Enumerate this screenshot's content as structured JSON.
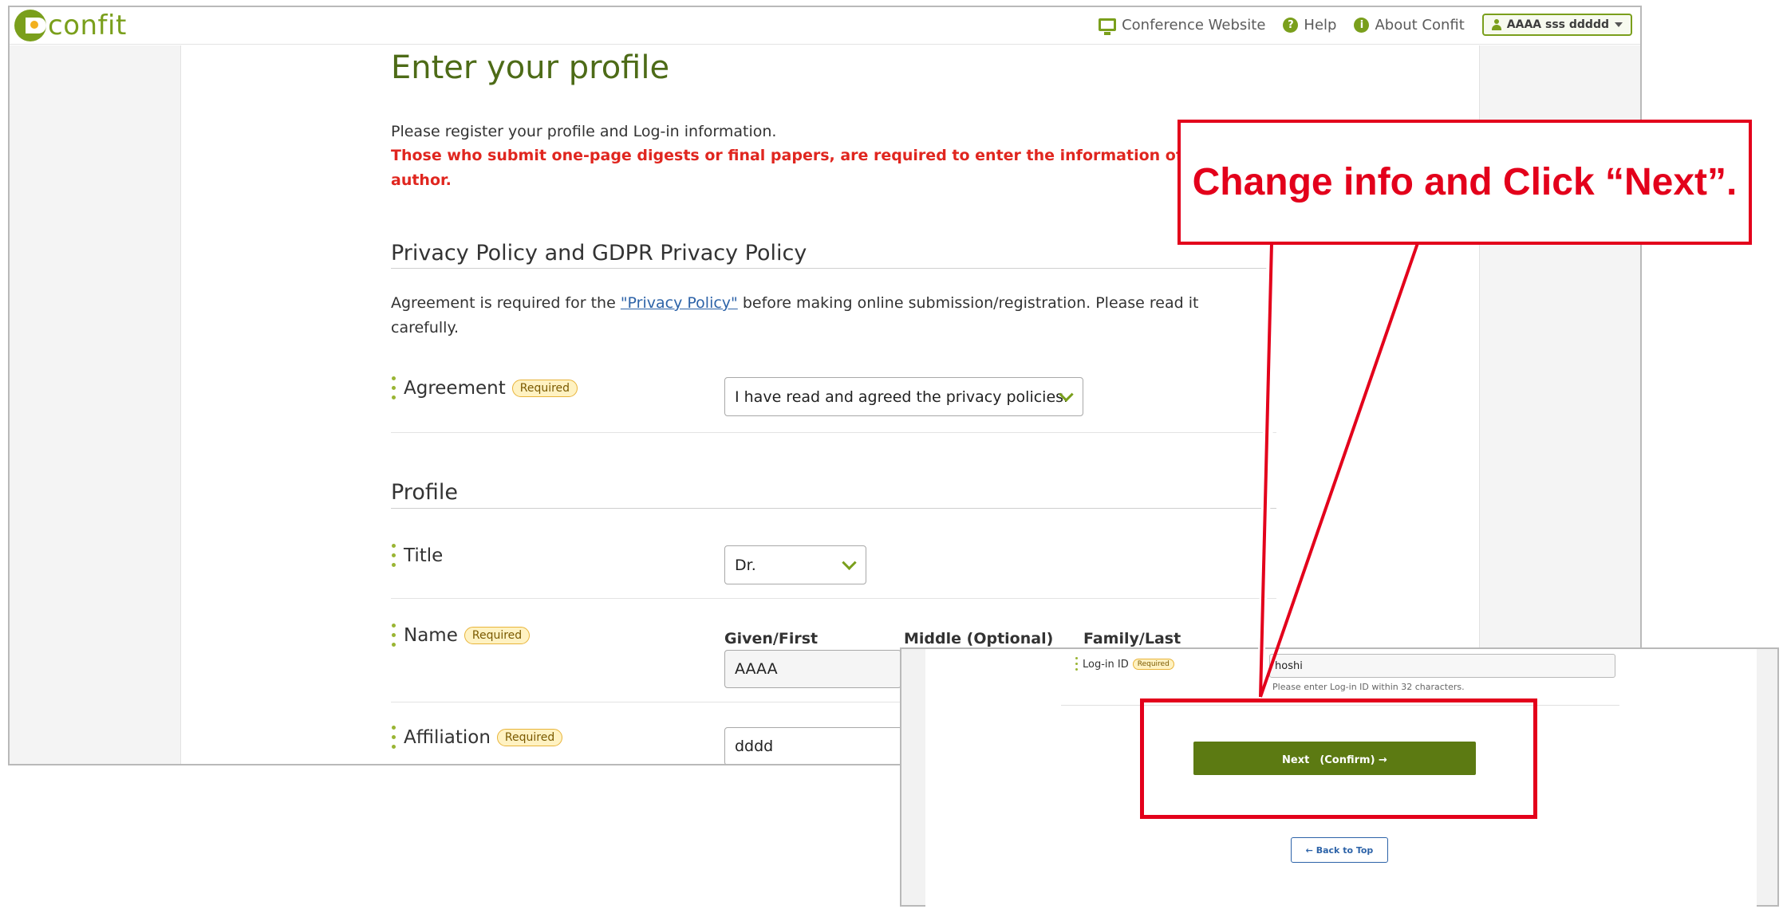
{
  "header": {
    "logo_text": "confit",
    "nav": {
      "conference_website": "Conference Website",
      "help": "Help",
      "about": "About Confit",
      "user": "AAAA sss ddddd"
    }
  },
  "page": {
    "title": "Enter your profile",
    "intro": "Please register your profile and Log-in information.",
    "warning_line1": "Those who submit one-page digests or final papers, are required to enter the information of th",
    "warning_line2": "author."
  },
  "privacy": {
    "heading": "Privacy Policy and GDPR Privacy Policy",
    "text_before": "Agreement is required for the ",
    "link": "\"Privacy Policy\"",
    "text_after": " before making online submission/registration. Please read it",
    "text_line2": "carefully.",
    "agreement_label": "Agreement",
    "required_badge": "Required",
    "agreement_value": "I have read and agreed the privacy policies."
  },
  "profile": {
    "heading": "Profile",
    "title_label": "Title",
    "title_value": "Dr.",
    "name_label": "Name",
    "name_required": "Required",
    "given_label": "Given/First",
    "middle_label": "Middle (Optional)",
    "family_label": "Family/Last",
    "given_value": "AAAA",
    "affiliation_label": "Affiliation",
    "affiliation_required": "Required",
    "affiliation_value": "dddd"
  },
  "overlay": {
    "login_label": "Log-in ID",
    "login_required": "Required",
    "login_value": "hoshi",
    "login_help": "Please enter Log-in ID within 32 characters.",
    "next_button": "Next　(Confirm)  →",
    "back_button": "←  Back to Top"
  },
  "annotation": {
    "callout_text": "Change info and Click “Next”.",
    "color": "#e3001b"
  },
  "colors": {
    "brand_green": "#7a9f1c",
    "title_green": "#4d6b17",
    "next_button_bg": "#5c7a12",
    "warning_red": "#e0261f",
    "link_blue": "#2d63a8"
  }
}
